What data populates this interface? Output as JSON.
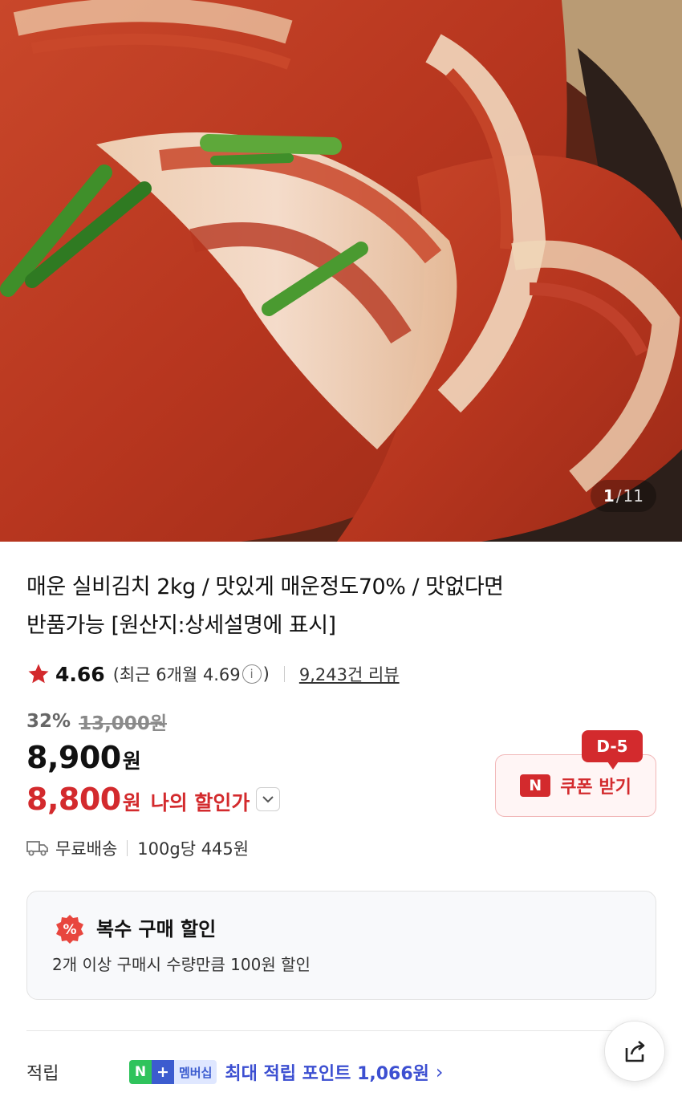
{
  "gallery": {
    "current": "1",
    "separator": "/",
    "total": "11"
  },
  "product": {
    "title_line1": "매운 실비김치 2kg / 맛있게 매운정도70% / 맛없다면",
    "title_line2": "반품가능 [원산지:상세설명에 표시]"
  },
  "rating": {
    "score": "4.66",
    "recent_prefix": "(최근 6개월 4.69",
    "recent_suffix": ")",
    "info_glyph": "i",
    "reviews": "9,243건 리뷰"
  },
  "pricing": {
    "discount_rate": "32%",
    "original_price": "13,000원",
    "price": "8,900",
    "currency": "원",
    "my_price": "8,800",
    "my_price_label": "나의 할인가"
  },
  "coupon": {
    "badge": "D-5",
    "logo": "N",
    "label": "쿠폰 받기"
  },
  "shipping": {
    "free": "무료배송",
    "unit_price": "100g당 445원"
  },
  "multi_buy": {
    "icon_glyph": "%",
    "title": "복수 구매 할인",
    "description": "2개 이상 구매시 수량만큼 100원 할인"
  },
  "points": {
    "label": "적립",
    "badge_n": "N",
    "badge_plus": "+",
    "badge_membership": "멤버십",
    "text": "최대 적립 포인트 1,066원",
    "chevron": "›"
  },
  "icons": {
    "star": "star-icon",
    "info": "info-icon",
    "chevron_down": "chevron-down-icon",
    "truck": "truck-icon",
    "percent": "percent-badge-icon",
    "share": "share-icon"
  },
  "colors": {
    "accent_red": "#d32a2d",
    "naver_green": "#2fc35c",
    "point_blue": "#3c4fd1"
  }
}
